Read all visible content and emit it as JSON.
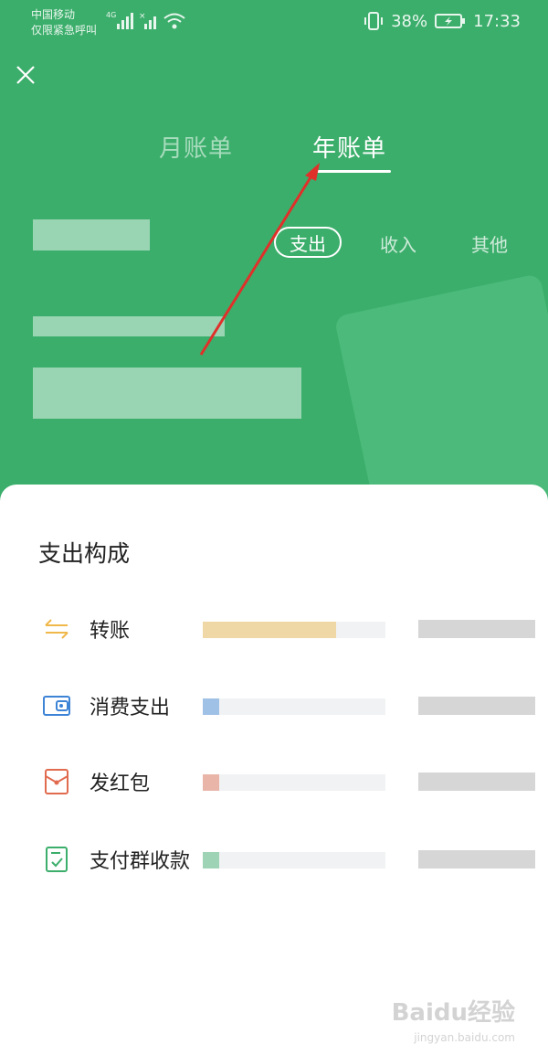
{
  "status_bar": {
    "carrier": "中国移动",
    "emergency": "仅限紧急呼叫",
    "network": "4G",
    "battery": "38%",
    "time": "17:33"
  },
  "tabs": [
    {
      "label": "月账单",
      "active": false
    },
    {
      "label": "年账单",
      "active": true
    }
  ],
  "filters": [
    {
      "label": "支出",
      "active": true
    },
    {
      "label": "收入",
      "active": false
    },
    {
      "label": "其他",
      "active": false
    }
  ],
  "sheet": {
    "title": "支出构成",
    "items": [
      {
        "label": "转账",
        "icon": "transfer-icon",
        "color": "#f0b84a",
        "share": 0.73
      },
      {
        "label": "消费支出",
        "icon": "wallet-icon",
        "color": "#3d84d6",
        "share": 0.09
      },
      {
        "label": "发红包",
        "icon": "red-envelope-icon",
        "color": "#e16b4f",
        "share": 0.09
      },
      {
        "label": "支付群收款",
        "icon": "group-receipt-icon",
        "color": "#3cae6b",
        "share": 0.09
      }
    ]
  },
  "watermark": {
    "brand": "Baidu经验",
    "url": "jingyan.baidu.com"
  },
  "colors": {
    "header_green": "#3cae6b",
    "arrow_red": "#e0302a"
  }
}
